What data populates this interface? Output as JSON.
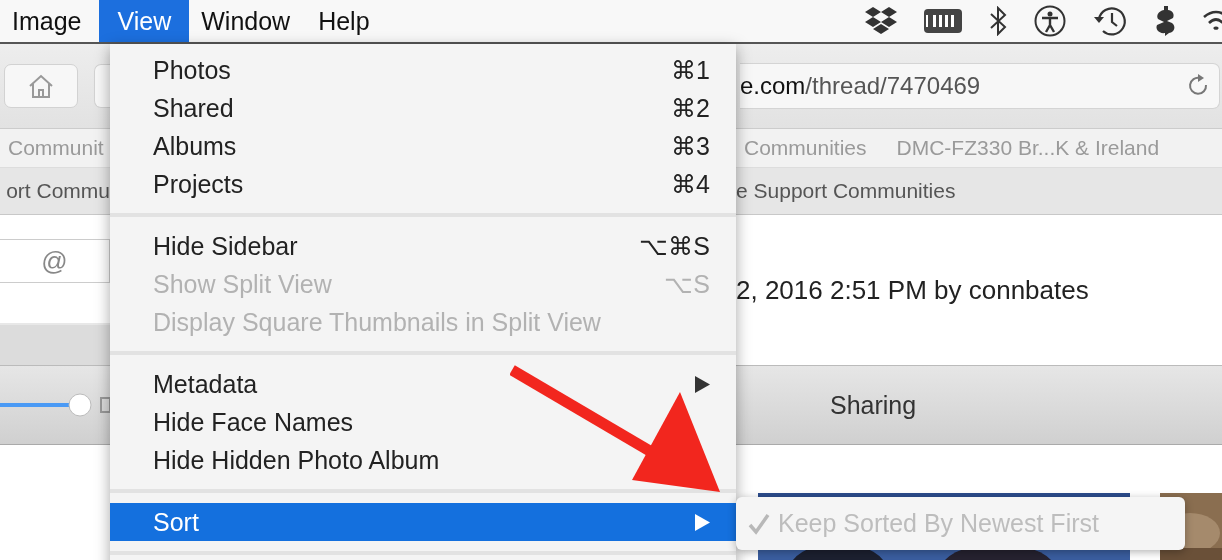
{
  "menubar": {
    "menus": [
      {
        "label": "Image",
        "selected": false
      },
      {
        "label": "View",
        "selected": true
      },
      {
        "label": "Window",
        "selected": false
      },
      {
        "label": "Help",
        "selected": false
      }
    ]
  },
  "browser": {
    "url_host": "e.com",
    "url_path": "/thread/7470469",
    "bookmarks_left": "Communit",
    "bookmarks_right": [
      "Communities",
      "DMC-FZ330 Br...K & Ireland"
    ],
    "tab_left": "ort Commu",
    "tab_right": "e Support Communities",
    "field_text": "@",
    "posted": "2, 2016 2:51 PM by connbates",
    "section_tab": "Sharing"
  },
  "view_menu": {
    "items": [
      {
        "kind": "item",
        "label": "Photos",
        "shortcut": "⌘1",
        "disabled": false,
        "selected": false,
        "submenu": false
      },
      {
        "kind": "item",
        "label": "Shared",
        "shortcut": "⌘2",
        "disabled": false,
        "selected": false,
        "submenu": false
      },
      {
        "kind": "item",
        "label": "Albums",
        "shortcut": "⌘3",
        "disabled": false,
        "selected": false,
        "submenu": false
      },
      {
        "kind": "item",
        "label": "Projects",
        "shortcut": "⌘4",
        "disabled": false,
        "selected": false,
        "submenu": false
      },
      {
        "kind": "separator"
      },
      {
        "kind": "item",
        "label": "Hide Sidebar",
        "shortcut": "⌥⌘S",
        "disabled": false,
        "selected": false,
        "submenu": false
      },
      {
        "kind": "item",
        "label": "Show Split View",
        "shortcut": "⌥S",
        "disabled": true,
        "selected": false,
        "submenu": false
      },
      {
        "kind": "item",
        "label": "Display Square Thumbnails in Split View",
        "disabled": true,
        "selected": false,
        "submenu": false
      },
      {
        "kind": "separator"
      },
      {
        "kind": "item",
        "label": "Metadata",
        "disabled": false,
        "selected": false,
        "submenu": true
      },
      {
        "kind": "item",
        "label": "Hide Face Names",
        "disabled": false,
        "selected": false,
        "submenu": false
      },
      {
        "kind": "item",
        "label": "Hide Hidden Photo Album",
        "disabled": false,
        "selected": false,
        "submenu": false
      },
      {
        "kind": "separator"
      },
      {
        "kind": "item",
        "label": "Sort",
        "disabled": false,
        "selected": true,
        "submenu": true
      },
      {
        "kind": "separator"
      }
    ]
  },
  "sort_submenu": {
    "items": [
      {
        "label": "Keep Sorted By Newest First",
        "checked": true,
        "disabled": true
      }
    ]
  }
}
